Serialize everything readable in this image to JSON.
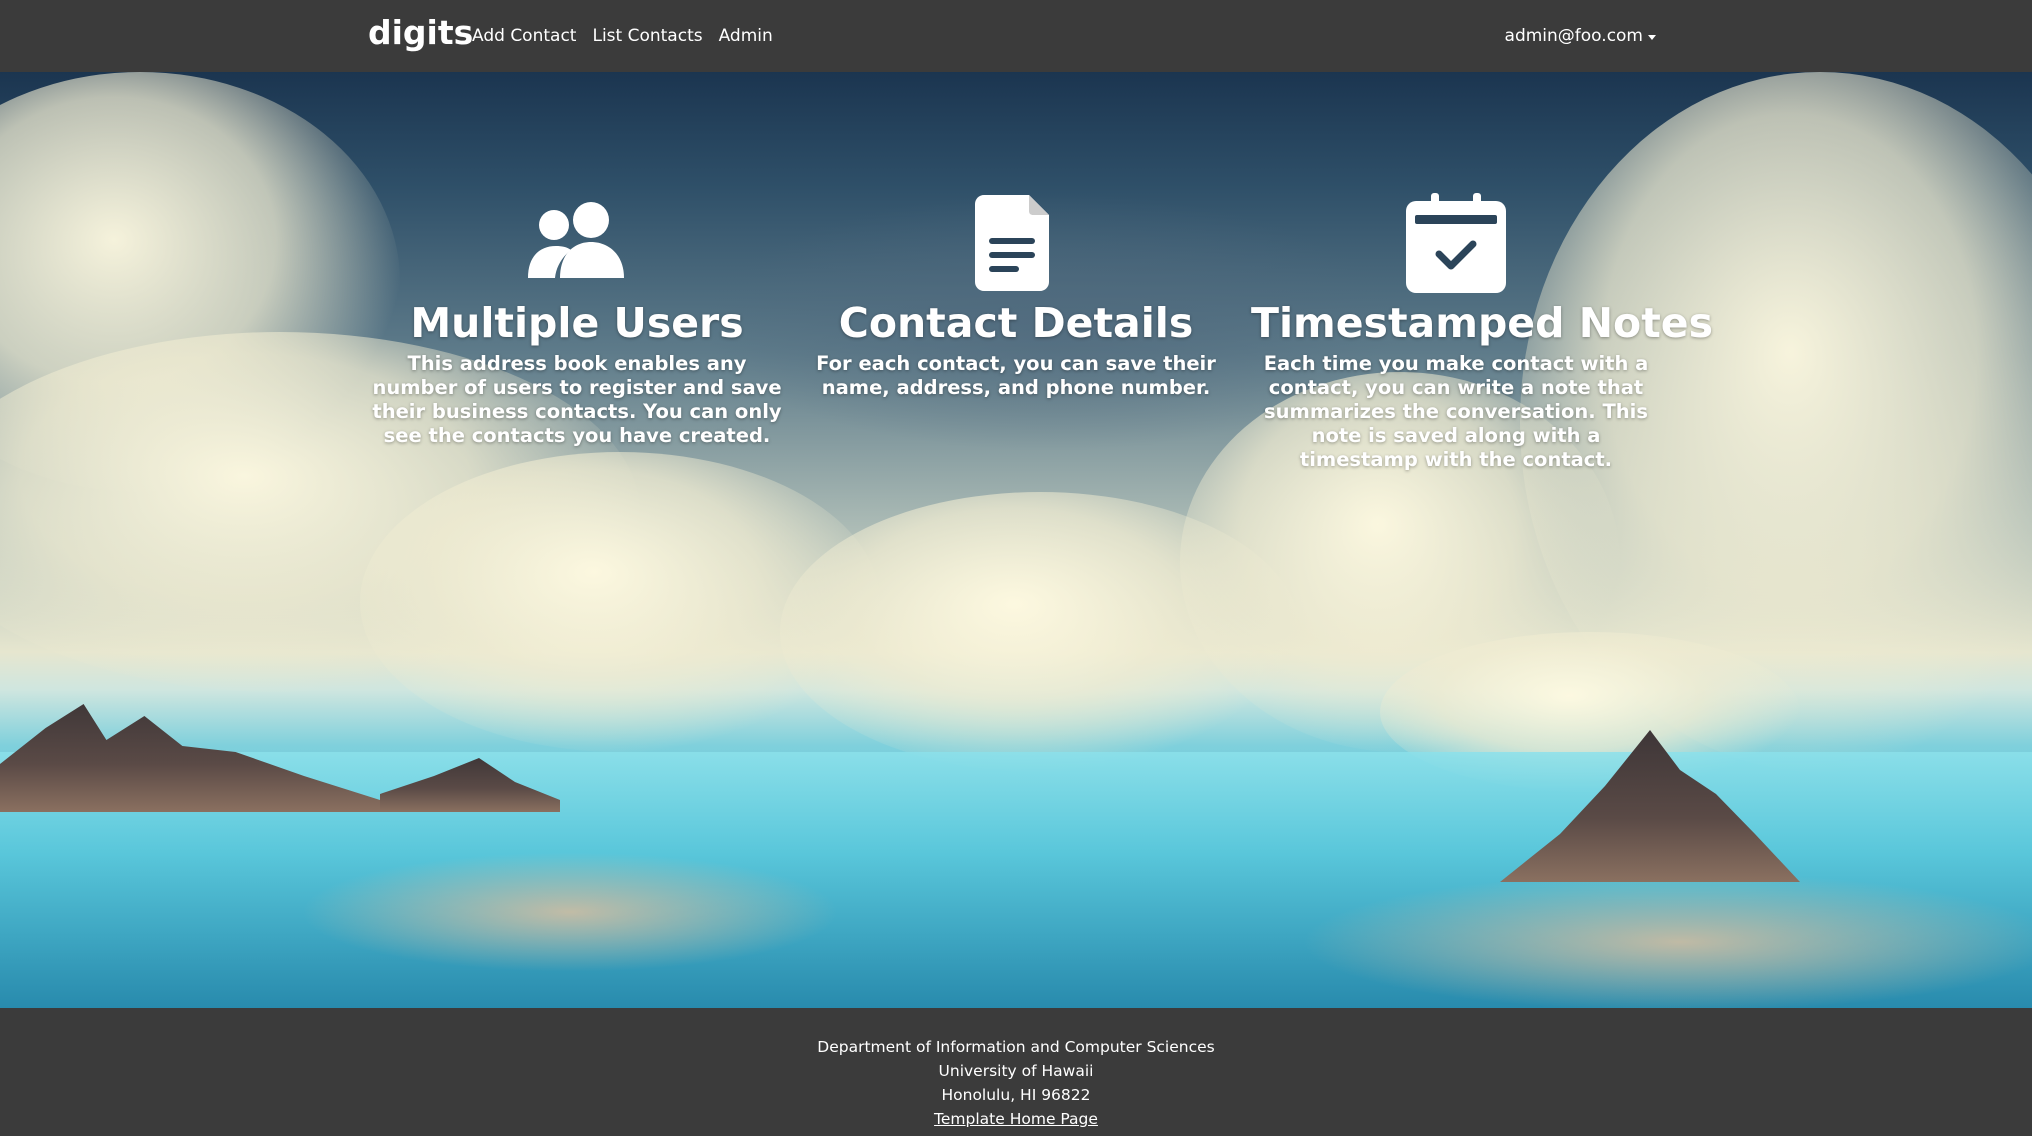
{
  "navbar": {
    "brand": "digits",
    "links": [
      "Add Contact",
      "List Contacts",
      "Admin"
    ],
    "user": "admin@foo.com"
  },
  "features": [
    {
      "icon": "users-icon",
      "title": "Multiple Users",
      "text": "This address book enables any number of users to register and save their business contacts. You can only see the contacts you have created."
    },
    {
      "icon": "file-lines-icon",
      "title": "Contact Details",
      "text": "For each contact, you can save their name, address, and phone number."
    },
    {
      "icon": "calendar-check-icon",
      "title": "Timestamped Notes",
      "text": "Each time you make contact with a contact, you can write a note that summarizes the conversation. This note is saved along with a timestamp with the contact."
    }
  ],
  "footer": {
    "lines": [
      "Department of Information and Computer Sciences",
      "University of Hawaii",
      "Honolulu, HI 96822"
    ],
    "link": "Template Home Page"
  },
  "colors": {
    "nav_bg": "#3b3b3b",
    "text": "#ffffff"
  }
}
